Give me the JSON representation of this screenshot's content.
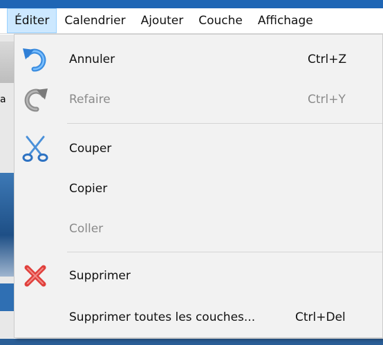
{
  "menubar": {
    "items": [
      {
        "label": "Éditer",
        "active": true
      },
      {
        "label": "Calendrier"
      },
      {
        "label": "Ajouter"
      },
      {
        "label": "Couche"
      },
      {
        "label": "Affichage"
      }
    ]
  },
  "edit_menu": {
    "items": [
      {
        "label": "Annuler",
        "shortcut": "Ctrl+Z",
        "icon": "undo-icon",
        "enabled": true
      },
      {
        "label": "Refaire",
        "shortcut": "Ctrl+Y",
        "icon": "redo-icon",
        "enabled": false
      },
      {
        "label": "Couper",
        "shortcut": "",
        "icon": "scissors-icon",
        "enabled": true
      },
      {
        "label": "Copier",
        "shortcut": "",
        "icon": "",
        "enabled": true
      },
      {
        "label": "Coller",
        "shortcut": "",
        "icon": "",
        "enabled": false
      },
      {
        "label": "Supprimer",
        "shortcut": "",
        "icon": "delete-x-icon",
        "enabled": true
      },
      {
        "label": "Supprimer toutes les couches...",
        "shortcut": "Ctrl+Del",
        "icon": "",
        "enabled": true
      }
    ]
  },
  "colors": {
    "menubar_active_bg": "#cce8ff",
    "disabled_text": "#8a8a8a",
    "undo_blue": "#3b8de0",
    "delete_red": "#e0403c"
  }
}
